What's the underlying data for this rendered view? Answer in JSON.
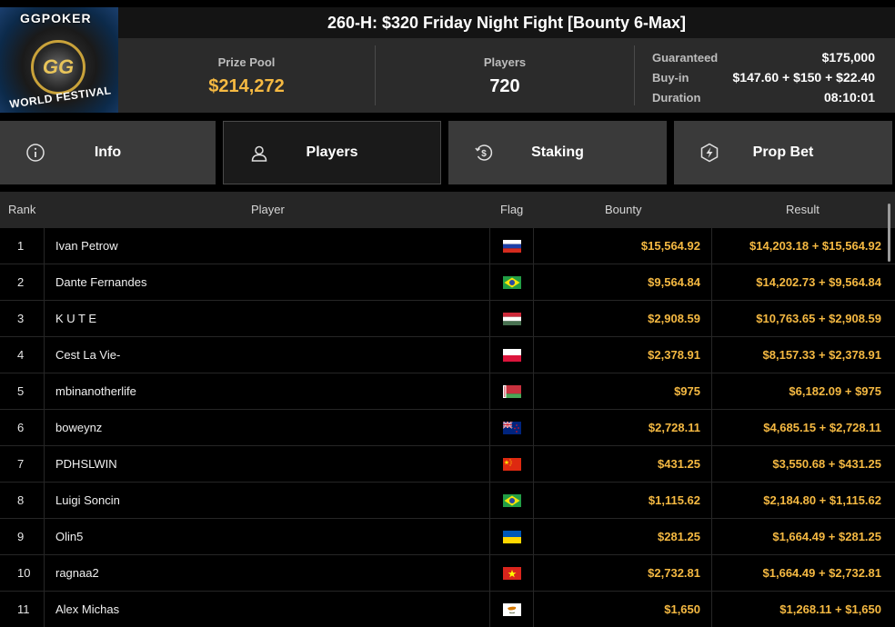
{
  "logo": {
    "top_text": "GGPOKER",
    "center_text": "GG",
    "bottom_text": "WORLD FESTIVAL"
  },
  "tournament": {
    "title": "260-H: $320 Friday Night Fight [Bounty 6-Max]"
  },
  "stats": {
    "prize_pool_label": "Prize Pool",
    "prize_pool_value": "$214,272",
    "players_label": "Players",
    "players_value": "720",
    "details": [
      {
        "label": "Guaranteed",
        "value": "$175,000"
      },
      {
        "label": "Buy-in",
        "value": "$147.60 + $150 + $22.40"
      },
      {
        "label": "Duration",
        "value": "08:10:01"
      }
    ]
  },
  "tabs": [
    {
      "label": "Info",
      "icon": "info-icon",
      "active": false
    },
    {
      "label": "Players",
      "icon": "user-icon",
      "active": true
    },
    {
      "label": "Staking",
      "icon": "dollar-coin-icon",
      "active": false
    },
    {
      "label": "Prop Bet",
      "icon": "lightning-hexagon-icon",
      "active": false
    }
  ],
  "table": {
    "headers": {
      "rank": "Rank",
      "player": "Player",
      "flag": "Flag",
      "bounty": "Bounty",
      "result": "Result"
    },
    "rows": [
      {
        "rank": "1",
        "player": "Ivan Petrow",
        "flag": "russia-flag-icon",
        "bounty": "$15,564.92",
        "result": "$14,203.18 + $15,564.92"
      },
      {
        "rank": "2",
        "player": "Dante Fernandes",
        "flag": "brazil-flag-icon",
        "bounty": "$9,564.84",
        "result": "$14,202.73 + $9,564.84"
      },
      {
        "rank": "3",
        "player": "K U T E",
        "flag": "hungary-flag-icon",
        "bounty": "$2,908.59",
        "result": "$10,763.65 + $2,908.59"
      },
      {
        "rank": "4",
        "player": "Cest La Vie-",
        "flag": "poland-flag-icon",
        "bounty": "$2,378.91",
        "result": "$8,157.33 + $2,378.91"
      },
      {
        "rank": "5",
        "player": "mbinanotherlife",
        "flag": "belarus-flag-icon",
        "bounty": "$975",
        "result": "$6,182.09 + $975"
      },
      {
        "rank": "6",
        "player": "boweynz",
        "flag": "new-zealand-flag-icon",
        "bounty": "$2,728.11",
        "result": "$4,685.15 + $2,728.11"
      },
      {
        "rank": "7",
        "player": "PDHSLWIN",
        "flag": "china-flag-icon",
        "bounty": "$431.25",
        "result": "$3,550.68 + $431.25"
      },
      {
        "rank": "8",
        "player": "Luigi Soncin",
        "flag": "brazil-flag-icon",
        "bounty": "$1,115.62",
        "result": "$2,184.80 + $1,115.62"
      },
      {
        "rank": "9",
        "player": "Olin5",
        "flag": "ukraine-flag-icon",
        "bounty": "$281.25",
        "result": "$1,664.49 + $281.25"
      },
      {
        "rank": "10",
        "player": "ragnaa2",
        "flag": "vietnam-flag-icon",
        "bounty": "$2,732.81",
        "result": "$1,664.49 + $2,732.81"
      },
      {
        "rank": "11",
        "player": "Alex Michas",
        "flag": "cyprus-flag-icon",
        "bounty": "$1,650",
        "result": "$1,268.11 + $1,650"
      }
    ]
  },
  "colors": {
    "accent_gold": "#f5b942",
    "panel": "#2b2b2b",
    "tab": "#3a3a3a",
    "tab_active": "#1a1a1a"
  }
}
